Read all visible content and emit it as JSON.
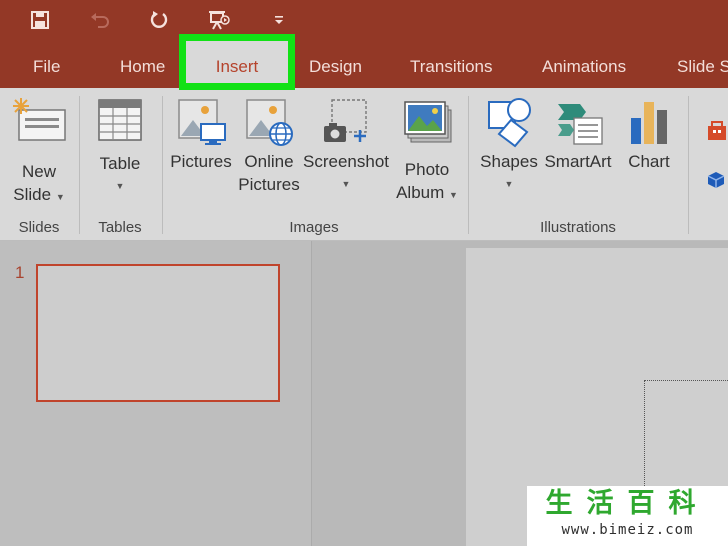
{
  "quick_access": {
    "icons": [
      "save-icon",
      "undo-icon",
      "redo-icon",
      "present-icon",
      "customize-qat-icon"
    ]
  },
  "tabs": [
    {
      "label": "File"
    },
    {
      "label": "Home"
    },
    {
      "label": "Insert",
      "active": true
    },
    {
      "label": "Design"
    },
    {
      "label": "Transitions"
    },
    {
      "label": "Animations"
    },
    {
      "label": "Slide Sl"
    }
  ],
  "ribbon": {
    "groups": {
      "slides": "Slides",
      "tables": "Tables",
      "images": "Images",
      "illustrations": "Illustrations"
    },
    "buttons": {
      "new_slide_1": "New",
      "new_slide_2": "Slide",
      "table": "Table",
      "pictures": "Pictures",
      "online_pictures_1": "Online",
      "online_pictures_2": "Pictures",
      "screenshot": "Screenshot",
      "photo_album_1": "Photo",
      "photo_album_2": "Album",
      "shapes": "Shapes",
      "smartart": "SmartArt",
      "chart": "Chart"
    }
  },
  "slides_pane": {
    "slide_number": "1"
  },
  "watermark": {
    "brand": "生活百科",
    "url": "www.bimeiz.com"
  },
  "colors": {
    "title_bar": "#933826",
    "ribbon": "#d9d9d9",
    "highlight": "#12e116",
    "accent": "#c0442c"
  }
}
